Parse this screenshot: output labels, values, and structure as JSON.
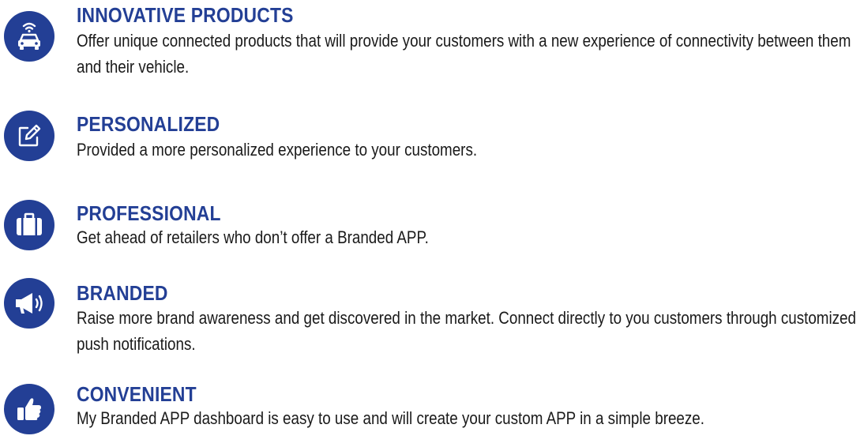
{
  "colors": {
    "accent": "#233f95",
    "text": "#1a1a1a",
    "background": "#ffffff"
  },
  "features": [
    {
      "icon": "connected-car-icon",
      "title": "INNOVATIVE PRODUCTS",
      "description": "Offer unique connected products that will provide your customers with a new experience of connectivity between them and their vehicle."
    },
    {
      "icon": "edit-icon",
      "title": "PERSONALIZED",
      "description": "Provided a more personalized experience to your customers."
    },
    {
      "icon": "briefcase-icon",
      "title": "PROFESSIONAL",
      "description": "Get ahead of retailers who don’t offer a Branded APP."
    },
    {
      "icon": "megaphone-icon",
      "title": "BRANDED",
      "description": "Raise more brand awareness and get discovered in the market. Connect directly to you customers through customized push notifications."
    },
    {
      "icon": "thumbs-up-icon",
      "title": "CONVENIENT",
      "description": "My Branded APP dashboard is easy to use and will create your custom APP in a simple breeze."
    }
  ]
}
